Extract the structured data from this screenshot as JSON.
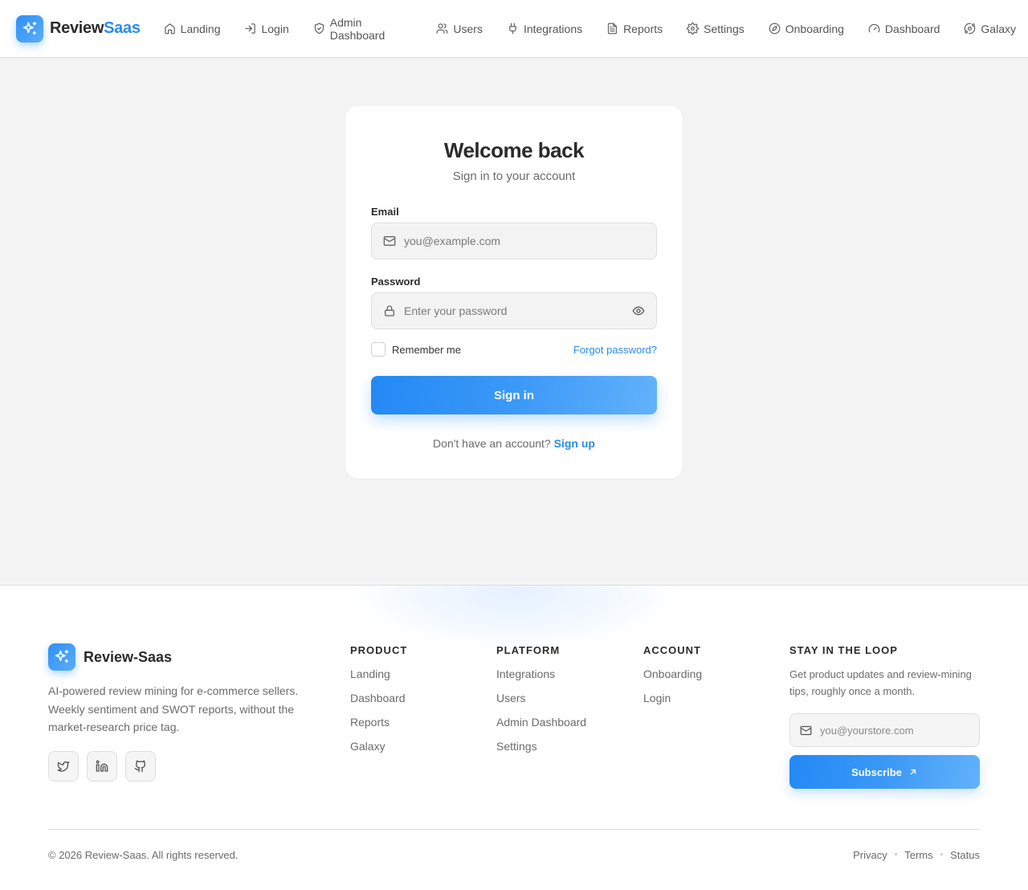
{
  "nav": {
    "brand_part1": "Review",
    "brand_part2": "Saas",
    "brand_icon": "sparkles-icon",
    "accent_color": "#2a8cf0",
    "items": [
      {
        "label": "Landing",
        "icon": "home-icon"
      },
      {
        "label": "Login",
        "icon": "login-icon"
      },
      {
        "label": "Admin Dashboard",
        "icon": "shield-icon"
      },
      {
        "label": "Users",
        "icon": "users-icon"
      },
      {
        "label": "Integrations",
        "icon": "plug-icon"
      },
      {
        "label": "Reports",
        "icon": "file-text-icon"
      },
      {
        "label": "Settings",
        "icon": "gear-icon"
      },
      {
        "label": "Onboarding",
        "icon": "compass-icon"
      },
      {
        "label": "Dashboard",
        "icon": "gauge-icon"
      },
      {
        "label": "Galaxy",
        "icon": "orbit-icon"
      }
    ]
  },
  "login": {
    "title": "Welcome back",
    "subtitle": "Sign in to your account",
    "email_label": "Email",
    "email_placeholder": "you@example.com",
    "email_value": "",
    "password_label": "Password",
    "password_placeholder": "Enter your password",
    "password_value": "",
    "remember_label": "Remember me",
    "remember_checked": false,
    "forgot_label": "Forgot password?",
    "submit_label": "Sign in",
    "signup_prompt": "Don't have an account?",
    "signup_link": "Sign up"
  },
  "footer": {
    "brand_name": "Review-Saas",
    "description": "AI-powered review mining for e-commerce sellers. Weekly sentiment and SWOT reports, without the market-research price tag.",
    "socials": [
      "twitter-icon",
      "linkedin-icon",
      "github-icon"
    ],
    "columns": [
      {
        "heading": "PRODUCT",
        "links": [
          "Landing",
          "Dashboard",
          "Reports",
          "Galaxy"
        ]
      },
      {
        "heading": "PLATFORM",
        "links": [
          "Integrations",
          "Users",
          "Admin Dashboard",
          "Settings"
        ]
      },
      {
        "heading": "ACCOUNT",
        "links": [
          "Onboarding",
          "Login"
        ]
      }
    ],
    "newsletter": {
      "heading": "STAY IN THE LOOP",
      "description": "Get product updates and review-mining tips, roughly once a month.",
      "placeholder": "you@yourstore.com",
      "value": "",
      "button_label": "Subscribe"
    },
    "copyright": "© 2026 Review-Saas. All rights reserved.",
    "legal_links": [
      "Privacy",
      "Terms",
      "Status"
    ]
  }
}
